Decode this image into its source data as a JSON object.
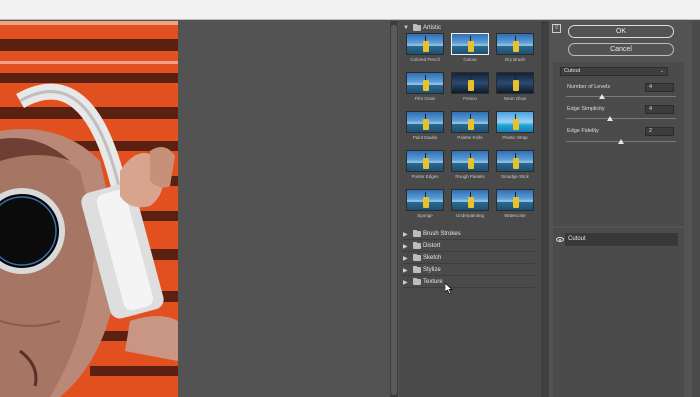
{
  "gallery": {
    "groups": {
      "artistic": "Artistic",
      "brush_strokes": "Brush Strokes",
      "distort": "Distort",
      "sketch": "Sketch",
      "stylize": "Stylize",
      "texture": "Texture"
    },
    "filters": [
      {
        "name": "Colored Pencil",
        "style": "normal"
      },
      {
        "name": "Cutout",
        "style": "selected"
      },
      {
        "name": "Dry Brush",
        "style": "normal"
      },
      {
        "name": "Film Grain",
        "style": "normal"
      },
      {
        "name": "Fresco",
        "style": "dark"
      },
      {
        "name": "Neon Glow",
        "style": "dark"
      },
      {
        "name": "Paint Daubs",
        "style": "normal"
      },
      {
        "name": "Palette Knife",
        "style": "normal"
      },
      {
        "name": "Plastic Wrap",
        "style": "cool"
      },
      {
        "name": "Poster Edges",
        "style": "normal"
      },
      {
        "name": "Rough Pastels",
        "style": "normal"
      },
      {
        "name": "Smudge Stick",
        "style": "normal"
      },
      {
        "name": "Sponge",
        "style": "normal"
      },
      {
        "name": "Underpainting",
        "style": "normal"
      },
      {
        "name": "Watercolor",
        "style": "normal"
      }
    ],
    "selected_filter": "Cutout"
  },
  "buttons": {
    "collapse": "⇧",
    "ok": "OK",
    "cancel": "Cancel"
  },
  "settings": {
    "filter_select": "Cutout",
    "params": [
      {
        "label": "Number of Levels",
        "value": "4",
        "slider_fraction": 0.33
      },
      {
        "label": "Edge Simplicity",
        "value": "4",
        "slider_fraction": 0.4
      },
      {
        "label": "Edge Fidelity",
        "value": "2",
        "slider_fraction": 0.5
      }
    ]
  },
  "layers": {
    "items": [
      {
        "label": "Cutout",
        "visible": true
      }
    ]
  },
  "colors": {
    "panel_bg": "#535353",
    "gallery_bg": "#4a4a4a",
    "preview_orange": "#ea5424"
  }
}
